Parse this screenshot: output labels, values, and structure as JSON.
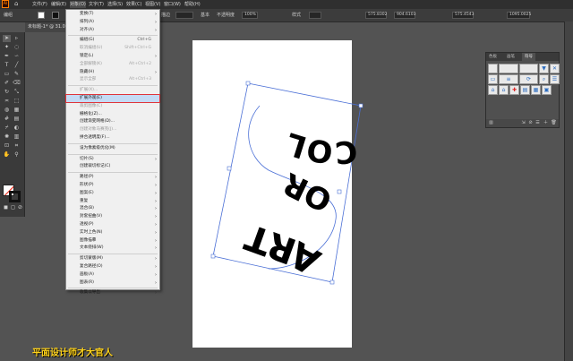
{
  "app": {
    "logo": "Ai"
  },
  "menubar": [
    {
      "label": "文件(F)",
      "active": false
    },
    {
      "label": "编辑(E)",
      "active": false
    },
    {
      "label": "对象(O)",
      "active": true
    },
    {
      "label": "文字(T)",
      "active": false
    },
    {
      "label": "选择(S)",
      "active": false
    },
    {
      "label": "效果(C)",
      "active": false
    },
    {
      "label": "视图(V)",
      "active": false
    },
    {
      "label": "窗口(W)",
      "active": false
    },
    {
      "label": "帮助(H)",
      "active": false
    }
  ],
  "control_bar": {
    "group_label": "编组",
    "stroke_label": "描边",
    "stroke_weight": "基本",
    "opacity_label": "不透明度",
    "opacity_value": "100%",
    "style_label": "样式",
    "x_value": "575.8302",
    "y_value": "904.6103",
    "w_value": "575.4543",
    "h_value": "1095.0025"
  },
  "document_tab": "未标题-1* @ 31.00",
  "object_menu": [
    {
      "label": "变换(T)",
      "shortcut": "",
      "submenu": true,
      "disabled": false
    },
    {
      "label": "排列(A)",
      "shortcut": "",
      "submenu": true,
      "disabled": false
    },
    {
      "label": "对齐(A)",
      "shortcut": "",
      "submenu": true,
      "disabled": false
    },
    {
      "sep": true
    },
    {
      "label": "编组(G)",
      "shortcut": "Ctrl+G",
      "submenu": false,
      "disabled": false
    },
    {
      "label": "取消编组(U)",
      "shortcut": "Shift+Ctrl+G",
      "submenu": false,
      "disabled": true
    },
    {
      "label": "锁定(L)",
      "shortcut": "",
      "submenu": true,
      "disabled": false
    },
    {
      "label": "全部解锁(K)",
      "shortcut": "Alt+Ctrl+2",
      "submenu": false,
      "disabled": true
    },
    {
      "label": "隐藏(H)",
      "shortcut": "",
      "submenu": true,
      "disabled": false
    },
    {
      "label": "显示全部",
      "shortcut": "Alt+Ctrl+3",
      "submenu": false,
      "disabled": true
    },
    {
      "sep": true
    },
    {
      "label": "扩展(X)...",
      "shortcut": "",
      "submenu": false,
      "disabled": true
    },
    {
      "label": "扩展外观(E)",
      "shortcut": "",
      "submenu": false,
      "disabled": false,
      "highlight": true
    },
    {
      "label": "裁剪图像(C)",
      "shortcut": "",
      "submenu": false,
      "disabled": true
    },
    {
      "label": "栅格化(Z)...",
      "shortcut": "",
      "submenu": false,
      "disabled": false
    },
    {
      "label": "创建渐变网格(D)...",
      "shortcut": "",
      "submenu": false,
      "disabled": false
    },
    {
      "label": "创建对象马赛克(J)...",
      "shortcut": "",
      "submenu": false,
      "disabled": true
    },
    {
      "label": "拼合透明度(F)...",
      "shortcut": "",
      "submenu": false,
      "disabled": false
    },
    {
      "sep": true
    },
    {
      "label": "设为像素级优化(M)",
      "shortcut": "",
      "submenu": false,
      "disabled": false
    },
    {
      "sep": true
    },
    {
      "label": "切片(S)",
      "shortcut": "",
      "submenu": true,
      "disabled": false
    },
    {
      "label": "创建裁切标记(C)",
      "shortcut": "",
      "submenu": false,
      "disabled": false
    },
    {
      "sep": true
    },
    {
      "label": "路径(P)",
      "shortcut": "",
      "submenu": true,
      "disabled": false
    },
    {
      "label": "形状(P)",
      "shortcut": "",
      "submenu": true,
      "disabled": false
    },
    {
      "label": "图案(E)",
      "shortcut": "",
      "submenu": true,
      "disabled": false
    },
    {
      "label": "重复",
      "shortcut": "",
      "submenu": true,
      "disabled": false
    },
    {
      "label": "混合(B)",
      "shortcut": "",
      "submenu": true,
      "disabled": false
    },
    {
      "label": "封套扭曲(V)",
      "shortcut": "",
      "submenu": true,
      "disabled": false
    },
    {
      "label": "透视(P)",
      "shortcut": "",
      "submenu": true,
      "disabled": false
    },
    {
      "label": "实时上色(N)",
      "shortcut": "",
      "submenu": true,
      "disabled": false
    },
    {
      "label": "图像描摹",
      "shortcut": "",
      "submenu": true,
      "disabled": false
    },
    {
      "label": "文本绕排(W)",
      "shortcut": "",
      "submenu": true,
      "disabled": false
    },
    {
      "sep": true
    },
    {
      "label": "剪切蒙版(M)",
      "shortcut": "",
      "submenu": true,
      "disabled": false
    },
    {
      "label": "复合路径(O)",
      "shortcut": "",
      "submenu": true,
      "disabled": false
    },
    {
      "label": "画板(A)",
      "shortcut": "",
      "submenu": true,
      "disabled": false
    },
    {
      "label": "图表(R)",
      "shortcut": "",
      "submenu": true,
      "disabled": false
    },
    {
      "sep": true
    },
    {
      "label": "收集以导出",
      "shortcut": "",
      "submenu": true,
      "disabled": false
    }
  ],
  "artwork": {
    "line1": "COL",
    "line2": "OR",
    "line3": "ART"
  },
  "symbols_panel": {
    "tabs": [
      {
        "label": "色板",
        "active": false
      },
      {
        "label": "画笔",
        "active": false
      },
      {
        "label": "符号",
        "active": true
      }
    ]
  },
  "watermark": "平面设计师才大官人"
}
